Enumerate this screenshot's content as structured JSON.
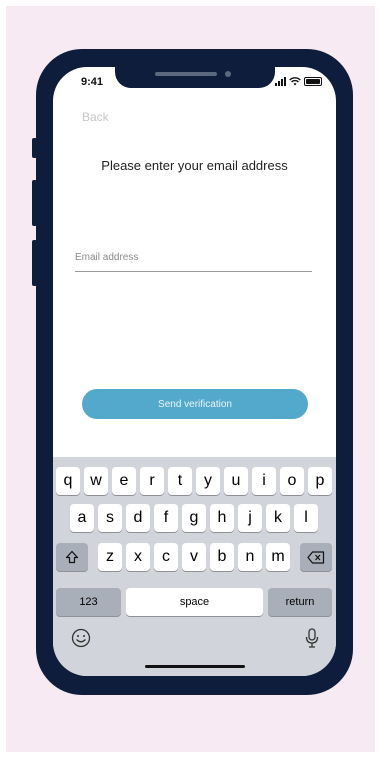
{
  "status_bar": {
    "time": "9:41"
  },
  "nav": {
    "back_label": "Back"
  },
  "content": {
    "title": "Please enter your email address",
    "email_label": "Email address",
    "send_label": "Send verification"
  },
  "keyboard": {
    "row1": [
      "q",
      "w",
      "e",
      "r",
      "t",
      "y",
      "u",
      "i",
      "o",
      "p"
    ],
    "row2": [
      "a",
      "s",
      "d",
      "f",
      "g",
      "h",
      "j",
      "k",
      "l"
    ],
    "row3": [
      "z",
      "x",
      "c",
      "v",
      "b",
      "n",
      "m"
    ],
    "numbers_label": "123",
    "space_label": "space",
    "return_label": "return"
  },
  "icons": [
    "signal-icon",
    "wifi-icon",
    "battery-icon",
    "shift-icon",
    "backspace-icon",
    "emoji-icon",
    "microphone-icon"
  ],
  "colors": {
    "frame": "#0e1d3b",
    "background": "#f7eaf3",
    "button": "#53a9cb",
    "keyboard": "#d1d5db"
  }
}
